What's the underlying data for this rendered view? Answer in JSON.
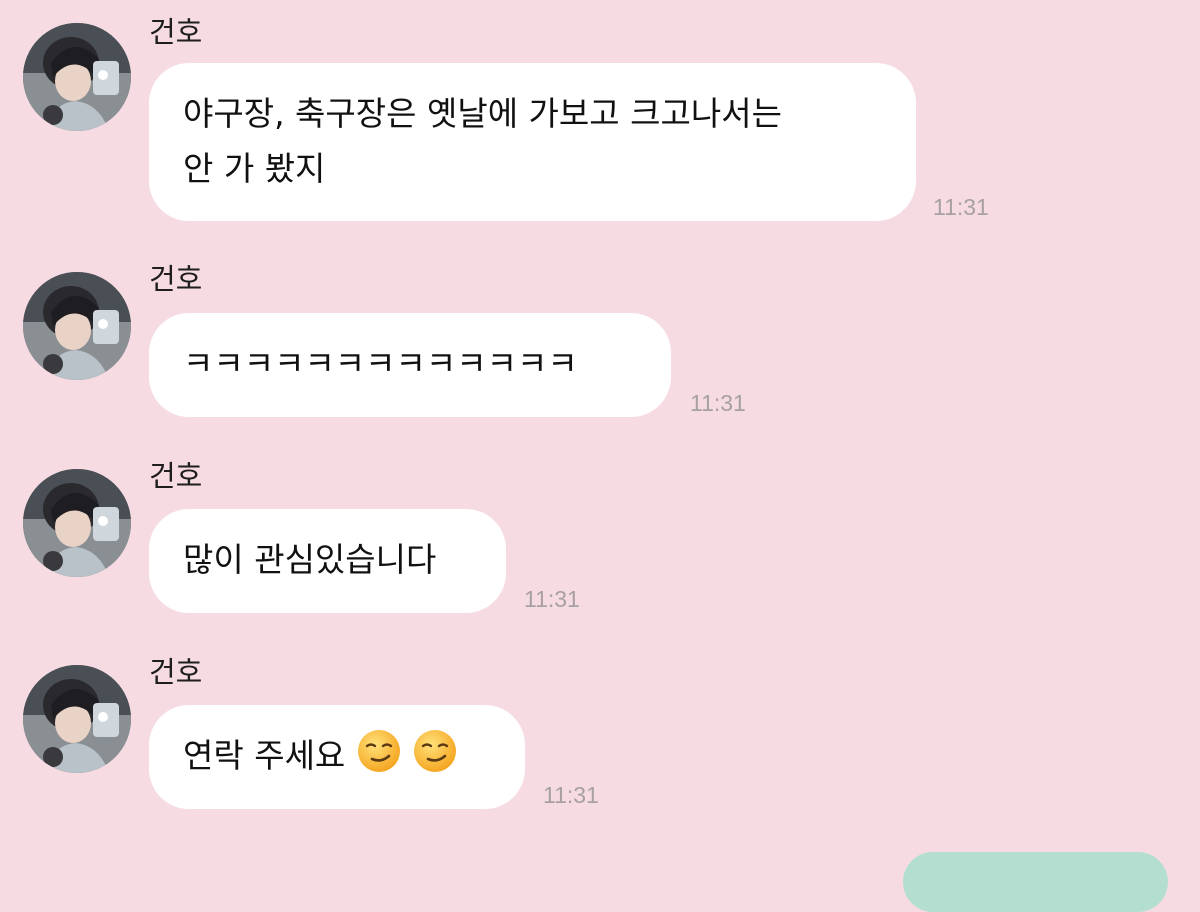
{
  "chat": {
    "messages": [
      {
        "sender": "건호",
        "line1": "야구장, 축구장은 옛날에 가보고 크고나서는",
        "line2": "안 가 봤지",
        "time": "11:31"
      },
      {
        "sender": "건호",
        "text": "ㅋㅋㅋㅋㅋㅋㅋㅋㅋㅋㅋㅋㅋ",
        "time": "11:31"
      },
      {
        "sender": "건호",
        "text": "많이 관심있습니다",
        "time": "11:31"
      },
      {
        "sender": "건호",
        "text": "연락 주세요",
        "emojis": [
          "smirking-face",
          "smirking-face"
        ],
        "time": "11:31"
      }
    ]
  },
  "colors": {
    "background": "#f6dce2",
    "incoming_bubble": "#ffffff",
    "outgoing_bubble": "#b4dfd0",
    "timestamp": "#a7a0a3"
  }
}
